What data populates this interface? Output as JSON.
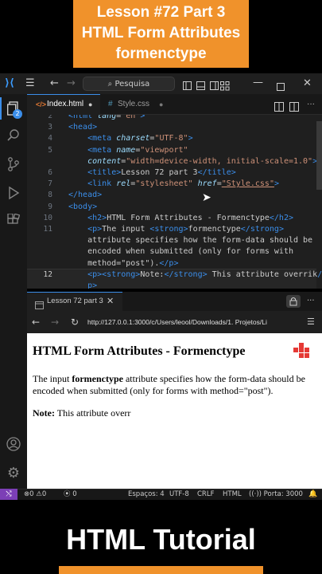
{
  "banner": {
    "line1": "Lesson #72 Part 3",
    "line2": "HTML Form Attributes",
    "line3": "formenctype"
  },
  "titlebar": {
    "search_label": "Pesquisa"
  },
  "activity": {
    "explorer_badge": "2"
  },
  "tabs": [
    {
      "label": "Index.html",
      "active": true
    },
    {
      "label": "Style.css",
      "active": false
    }
  ],
  "editor": {
    "lines": [
      {
        "n": "2",
        "html": "<span class=\"t\">&lt;html</span> <span class=\"a\">lang</span>=<span class=\"s\">\"en\"</span><span class=\"t\">&gt;</span>"
      },
      {
        "n": "3",
        "html": "<span class=\"t\">&lt;head&gt;</span>"
      },
      {
        "n": "4",
        "html": "    <span class=\"t\">&lt;meta</span> <span class=\"a\">charset</span>=<span class=\"s\">\"UTF-8\"</span><span class=\"t\">&gt;</span>"
      },
      {
        "n": "5",
        "html": "    <span class=\"t\">&lt;meta</span> <span class=\"a\">name</span>=<span class=\"s\">\"viewport\"</span>"
      },
      {
        "n": "",
        "html": "    <span class=\"a\">content</span>=<span class=\"s\">\"width=device-width, initial-scale=1.0\"</span><span class=\"t\">&gt;</span>"
      },
      {
        "n": "6",
        "html": "    <span class=\"t\">&lt;title&gt;</span>Lesson 72 part 3<span class=\"t\">&lt;/title&gt;</span>"
      },
      {
        "n": "7",
        "html": "    <span class=\"t\">&lt;link</span> <span class=\"a\">rel</span>=<span class=\"s\">\"stylesheet\"</span> <span class=\"a\">href</span>=<span class=\"s\" style=\"text-decoration:underline\">\"Style.css\"</span><span class=\"t\">&gt;</span>"
      },
      {
        "n": "8",
        "html": "<span class=\"t\">&lt;/head&gt;</span>"
      },
      {
        "n": "9",
        "html": "<span class=\"t\">&lt;body&gt;</span>"
      },
      {
        "n": "10",
        "html": "    <span class=\"t\">&lt;h2&gt;</span>HTML Form Attributes - Formenctype<span class=\"t\">&lt;/h2&gt;</span>"
      },
      {
        "n": "11",
        "html": "    <span class=\"t\">&lt;p&gt;</span>The input <span class=\"t\">&lt;strong&gt;</span>formenctype<span class=\"t\">&lt;/strong&gt;</span>"
      },
      {
        "n": "",
        "html": "    attribute specifies how the form-data should be"
      },
      {
        "n": "",
        "html": "    encoded when submitted (only for forms with"
      },
      {
        "n": "",
        "html": "    method=\"post\").<span class=\"t\">&lt;/p&gt;</span>"
      },
      {
        "n": "12",
        "html": "    <span class=\"t\">&lt;p&gt;&lt;strong&gt;</span>Note:<span class=\"t\">&lt;/strong&gt;</span> This attribute overrik<span class=\"t\">/</span>"
      },
      {
        "n": "",
        "html": "    <span class=\"t\">p&gt;</span>"
      }
    ]
  },
  "preview": {
    "tab_label": "Lesson 72 part 3",
    "url": "http://127.0.0.1:3000/c/Users/leool/Downloads/1. Projetos/Li",
    "heading": "HTML Form Attributes - Formenctype",
    "p1_before": "The input ",
    "p1_strong": "formenctype",
    "p1_after": " attribute specifies how the form-data should be encoded when submitted (only for forms with method=\"post\").",
    "p2_strong": "Note:",
    "p2_after": " This attribute overr"
  },
  "status": {
    "errors": "0",
    "warnings": "0",
    "ports": "0",
    "spaces": "Espaços: 4",
    "encoding": "UTF-8",
    "eol": "CRLF",
    "language": "HTML",
    "port": "Porta: 3000"
  },
  "footer": {
    "title": "HTML Tutorial"
  },
  "colors": {
    "accent": "#f0922b",
    "editor_bg": "#1f1f1f",
    "status_bg": "#181818"
  }
}
